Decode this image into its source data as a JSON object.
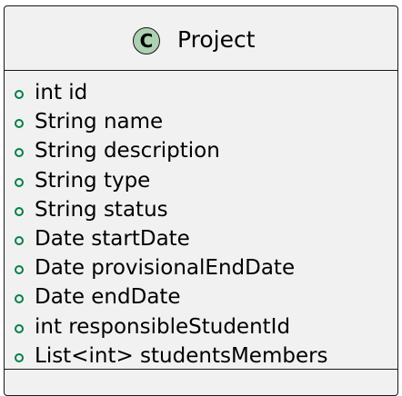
{
  "class": {
    "stereotype_letter": "C",
    "name": "Project",
    "fields": [
      {
        "text": "int id",
        "visibility": "public"
      },
      {
        "text": "String name",
        "visibility": "public"
      },
      {
        "text": "String description",
        "visibility": "public"
      },
      {
        "text": "String type",
        "visibility": "public"
      },
      {
        "text": "String status",
        "visibility": "public"
      },
      {
        "text": "Date startDate",
        "visibility": "public"
      },
      {
        "text": "Date provisionalEndDate",
        "visibility": "public"
      },
      {
        "text": "Date endDate",
        "visibility": "public"
      },
      {
        "text": "int responsibleStudentId",
        "visibility": "public"
      },
      {
        "text": "List<int> studentsMembers",
        "visibility": "public"
      }
    ]
  },
  "colors": {
    "box_fill": "#f1f1f1",
    "border": "#181818",
    "class_badge": "#add1b2",
    "public_visibility_icon": "#038048"
  },
  "icons": {
    "stereotype": "class-stereotype-icon",
    "visibility": "public-visibility-icon"
  }
}
